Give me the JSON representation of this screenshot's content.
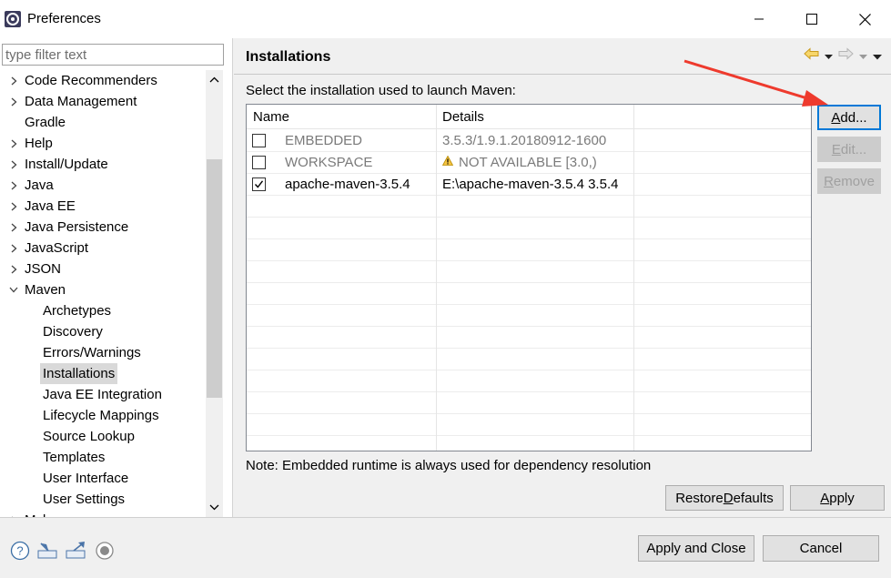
{
  "window": {
    "title": "Preferences"
  },
  "filter": {
    "placeholder": "type filter text"
  },
  "tree": {
    "items": [
      {
        "label": "Code Recommenders",
        "level": 0,
        "expandable": true,
        "expanded": false
      },
      {
        "label": "Data Management",
        "level": 0,
        "expandable": true,
        "expanded": false
      },
      {
        "label": "Gradle",
        "level": 0,
        "expandable": false,
        "expanded": false
      },
      {
        "label": "Help",
        "level": 0,
        "expandable": true,
        "expanded": false
      },
      {
        "label": "Install/Update",
        "level": 0,
        "expandable": true,
        "expanded": false
      },
      {
        "label": "Java",
        "level": 0,
        "expandable": true,
        "expanded": false
      },
      {
        "label": "Java EE",
        "level": 0,
        "expandable": true,
        "expanded": false
      },
      {
        "label": "Java Persistence",
        "level": 0,
        "expandable": true,
        "expanded": false
      },
      {
        "label": "JavaScript",
        "level": 0,
        "expandable": true,
        "expanded": false
      },
      {
        "label": "JSON",
        "level": 0,
        "expandable": true,
        "expanded": false
      },
      {
        "label": "Maven",
        "level": 0,
        "expandable": true,
        "expanded": true
      },
      {
        "label": "Archetypes",
        "level": 1,
        "expandable": false,
        "expanded": false
      },
      {
        "label": "Discovery",
        "level": 1,
        "expandable": false,
        "expanded": false
      },
      {
        "label": "Errors/Warnings",
        "level": 1,
        "expandable": false,
        "expanded": false
      },
      {
        "label": "Installations",
        "level": 1,
        "expandable": false,
        "expanded": false,
        "selected": true
      },
      {
        "label": "Java EE Integration",
        "level": 1,
        "expandable": false,
        "expanded": false
      },
      {
        "label": "Lifecycle Mappings",
        "level": 1,
        "expandable": false,
        "expanded": false
      },
      {
        "label": "Source Lookup",
        "level": 1,
        "expandable": false,
        "expanded": false
      },
      {
        "label": "Templates",
        "level": 1,
        "expandable": false,
        "expanded": false
      },
      {
        "label": "User Interface",
        "level": 1,
        "expandable": false,
        "expanded": false
      },
      {
        "label": "User Settings",
        "level": 1,
        "expandable": false,
        "expanded": false
      },
      {
        "label": "Mylyn",
        "level": 0,
        "expandable": true,
        "expanded": false
      }
    ]
  },
  "page": {
    "title": "Installations",
    "instruction": "Select the installation used to launch Maven:",
    "note": "Note: Embedded runtime is always used for dependency resolution"
  },
  "table": {
    "columns": [
      "Name",
      "Details"
    ],
    "rows": [
      {
        "name": "EMBEDDED",
        "details": "3.5.3/1.9.1.20180912-1600",
        "checked": false,
        "muted": true,
        "warning": false
      },
      {
        "name": "WORKSPACE",
        "details": "NOT AVAILABLE [3.0,)",
        "checked": false,
        "muted": true,
        "warning": true
      },
      {
        "name": "apache-maven-3.5.4",
        "details": "E:\\apache-maven-3.5.4 3.5.4",
        "checked": true,
        "muted": false,
        "warning": false
      }
    ]
  },
  "buttons": {
    "add": {
      "pre": "",
      "mnemonic": "A",
      "post": "dd..."
    },
    "edit": {
      "pre": "",
      "mnemonic": "E",
      "post": "dit..."
    },
    "remove": {
      "pre": "",
      "mnemonic": "R",
      "post": "emove"
    },
    "restore_defaults": {
      "pre": "Restore ",
      "mnemonic": "D",
      "post": "efaults"
    },
    "apply": {
      "pre": "",
      "mnemonic": "A",
      "post": "pply"
    },
    "apply_and_close": "Apply and Close",
    "cancel": "Cancel"
  },
  "icons": {
    "help": "help-icon",
    "import": "import-icon",
    "export": "export-icon",
    "record": "record-icon",
    "back": "back-arrow-icon",
    "forward": "forward-arrow-icon",
    "menu": "view-menu-icon",
    "warning": "warning-icon"
  },
  "colors": {
    "selection": "#d9d9d9",
    "focus_border": "#0078d7",
    "annotation_arrow": "#ee3a2d",
    "muted_text": "#7a7a7a"
  }
}
